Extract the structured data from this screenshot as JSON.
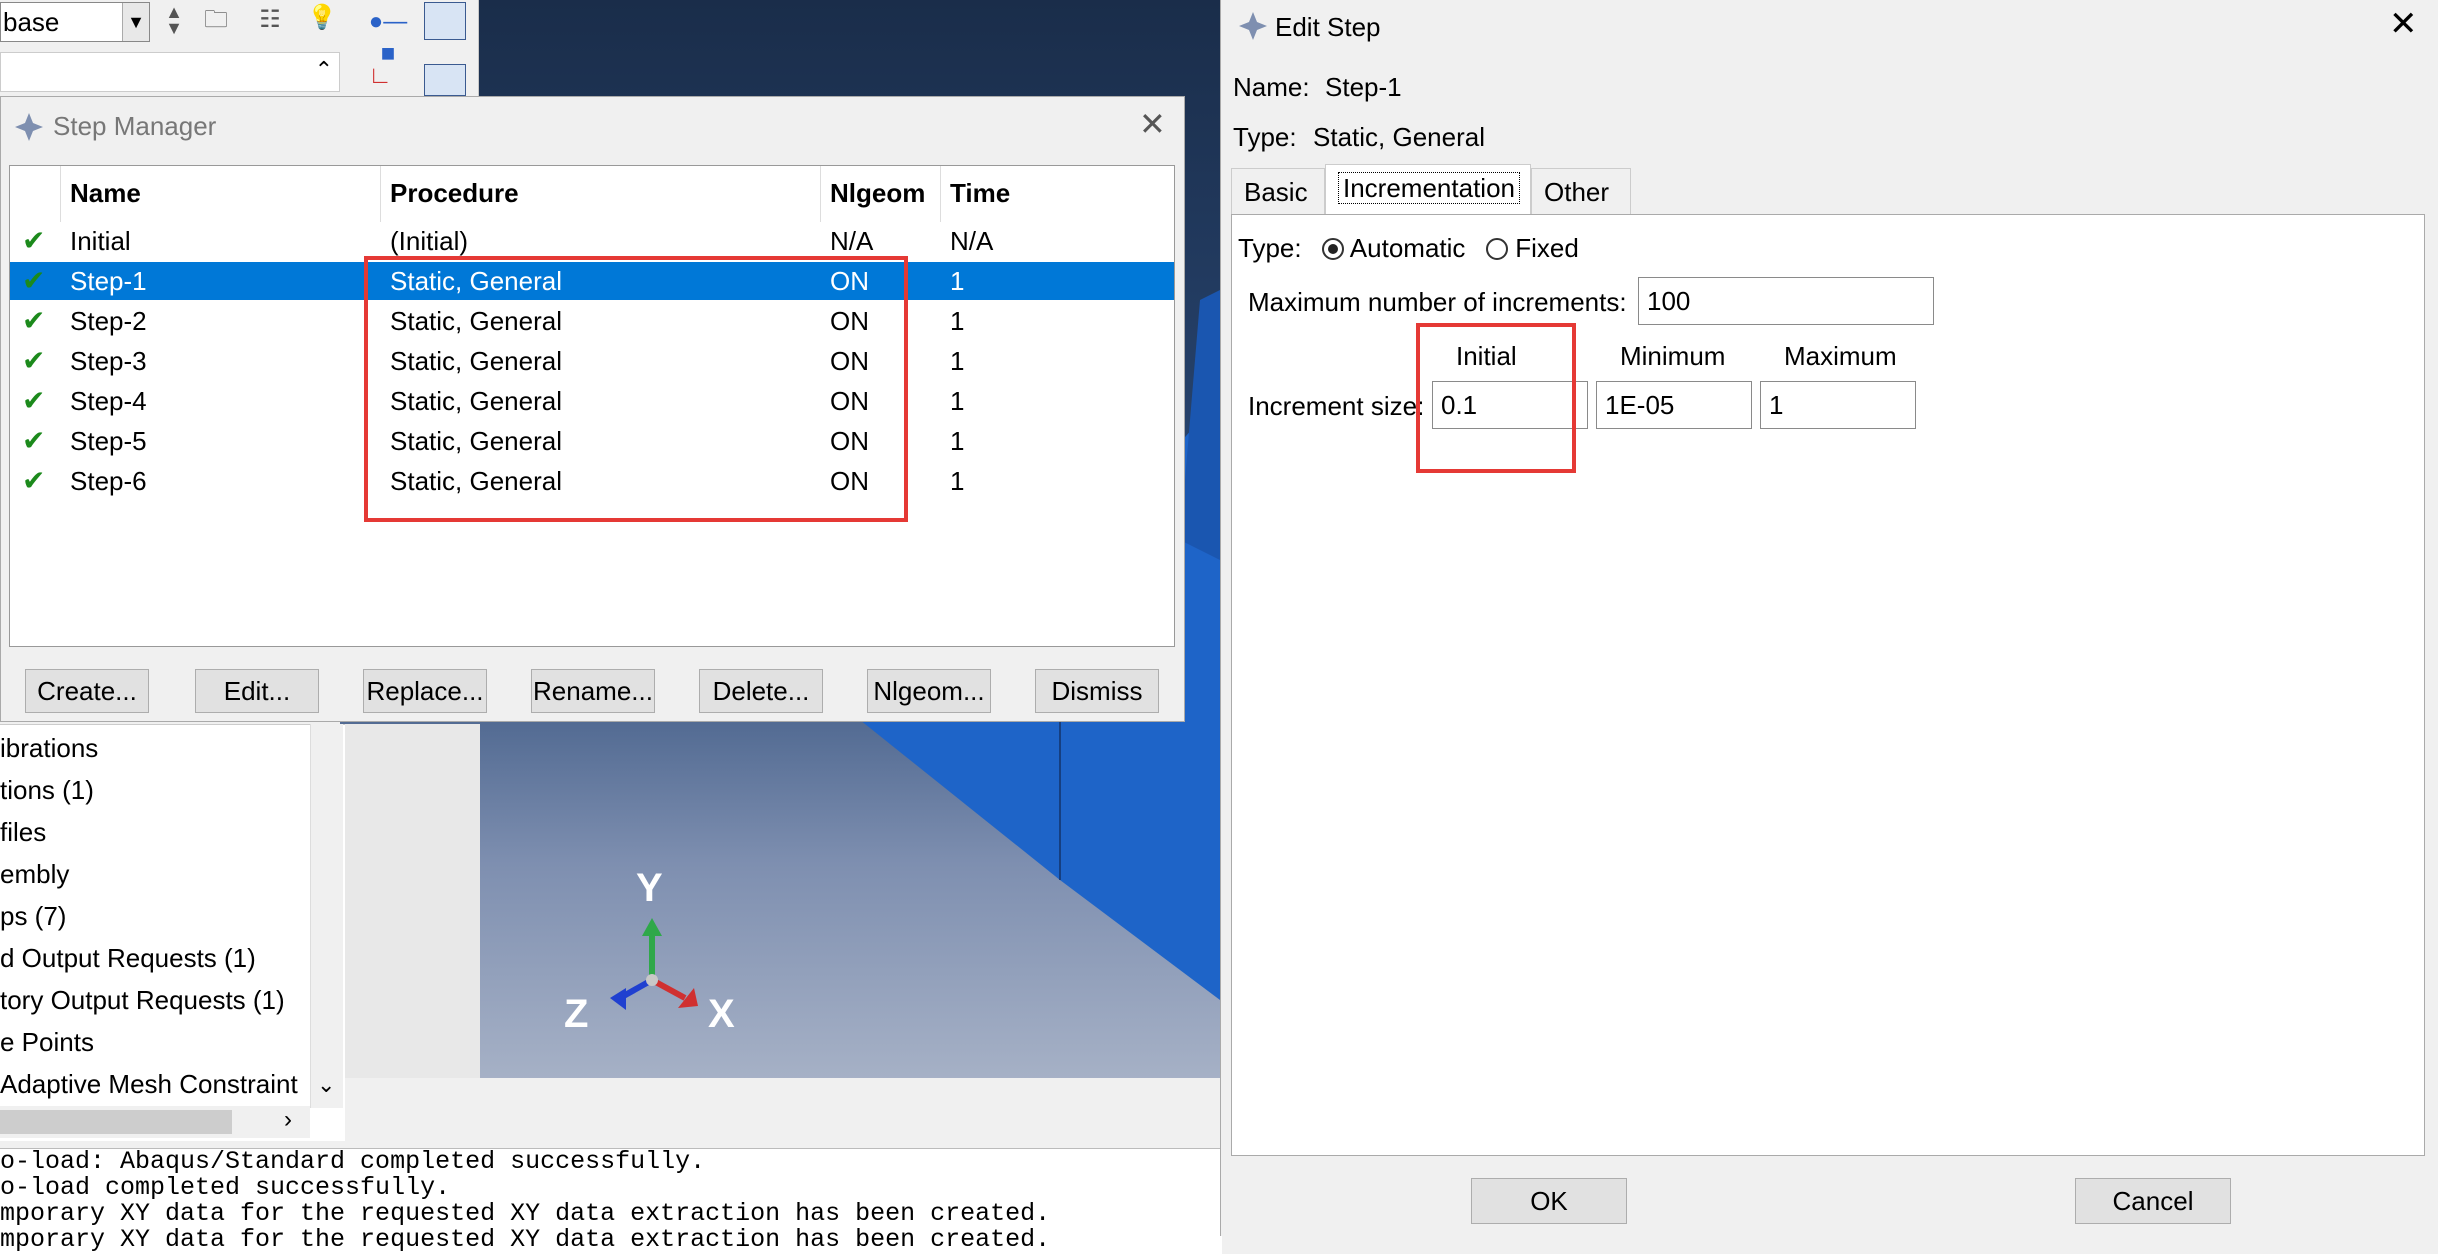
{
  "toolbar": {
    "combo_value": "base"
  },
  "tree": {
    "items": [
      "ibrations",
      "tions (1)",
      "files",
      "embly",
      "ps (7)",
      "d Output Requests (1)",
      "tory Output Requests (1)",
      "e Points",
      " Adaptive Mesh Constraint"
    ]
  },
  "console": {
    "lines": [
      "o-load: Abaqus/Standard completed successfully.",
      "o-load completed successfully.",
      "mporary XY data for the requested XY data extraction has been created.",
      "mporary XY data for the requested XY data extraction has been created."
    ]
  },
  "axes": {
    "y": "Y",
    "z": "Z",
    "x": "X"
  },
  "step_manager": {
    "title": "Step Manager",
    "columns": [
      "Name",
      "Procedure",
      "Nlgeom",
      "Time"
    ],
    "rows": [
      {
        "name": "Initial",
        "procedure": "(Initial)",
        "nlgeom": "N/A",
        "time": "N/A"
      },
      {
        "name": "Step-1",
        "procedure": "Static, General",
        "nlgeom": "ON",
        "time": "1"
      },
      {
        "name": "Step-2",
        "procedure": "Static, General",
        "nlgeom": "ON",
        "time": "1"
      },
      {
        "name": "Step-3",
        "procedure": "Static, General",
        "nlgeom": "ON",
        "time": "1"
      },
      {
        "name": "Step-4",
        "procedure": "Static, General",
        "nlgeom": "ON",
        "time": "1"
      },
      {
        "name": "Step-5",
        "procedure": "Static, General",
        "nlgeom": "ON",
        "time": "1"
      },
      {
        "name": "Step-6",
        "procedure": "Static, General",
        "nlgeom": "ON",
        "time": "1"
      }
    ],
    "buttons": [
      "Create...",
      "Edit...",
      "Replace...",
      "Rename...",
      "Delete...",
      "Nlgeom...",
      "Dismiss"
    ]
  },
  "edit_step": {
    "title": "Edit Step",
    "name_label": "Name:",
    "name_value": "Step-1",
    "type_label": "Type:",
    "type_value": "Static, General",
    "tabs": [
      "Basic",
      "Incrementation",
      "Other"
    ],
    "incr_type_label": "Type:",
    "incr_type_options": [
      "Automatic",
      "Fixed"
    ],
    "max_increments_label": "Maximum number of increments:",
    "max_increments_value": "100",
    "col_initial": "Initial",
    "col_minimum": "Minimum",
    "col_maximum": "Maximum",
    "increment_size_label": "Increment size:",
    "initial_value": "0.1",
    "minimum_value": "1E-05",
    "maximum_value": "1",
    "ok": "OK",
    "cancel": "Cancel"
  },
  "colors": {
    "selection": "#0078d7",
    "highlight": "#e53935",
    "check": "#1c8a1c"
  }
}
